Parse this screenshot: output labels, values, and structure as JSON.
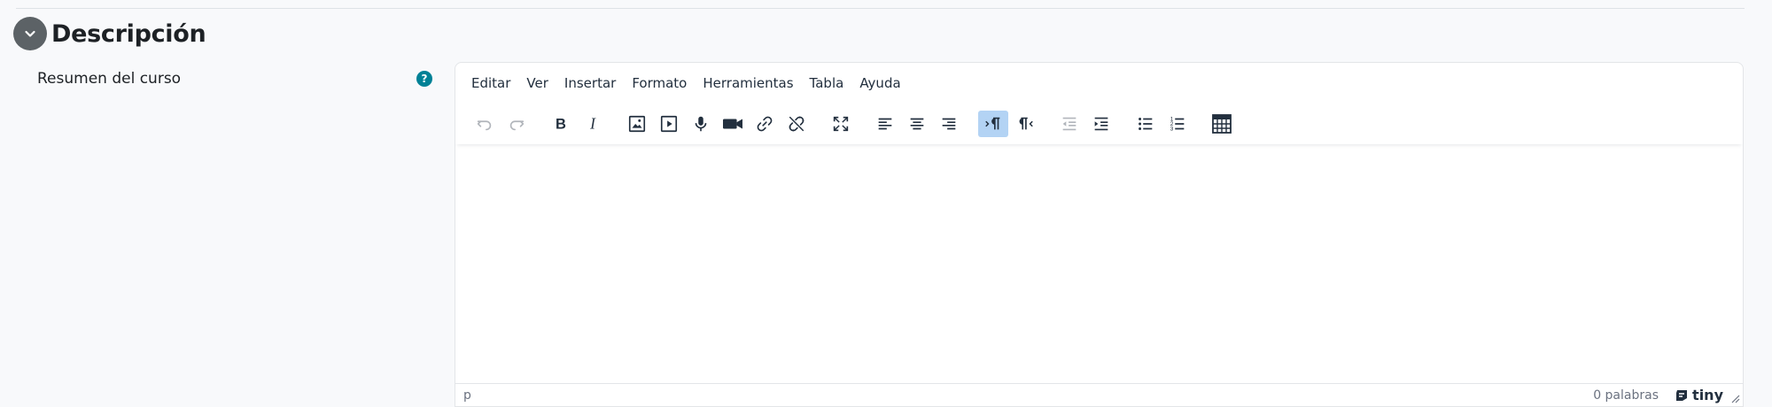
{
  "section": {
    "title": "Descripción"
  },
  "field": {
    "label": "Resumen del curso",
    "help_glyph": "?"
  },
  "editor": {
    "menus": [
      "Editar",
      "Ver",
      "Insertar",
      "Formato",
      "Herramientas",
      "Tabla",
      "Ayuda"
    ],
    "content": "",
    "status": {
      "path": "p",
      "wordcount": "0 palabras",
      "brand": "tiny"
    }
  },
  "colors": {
    "help_icon": "#008196",
    "collapse_button": "#5c6266",
    "active_button": "#b3d3f4"
  }
}
